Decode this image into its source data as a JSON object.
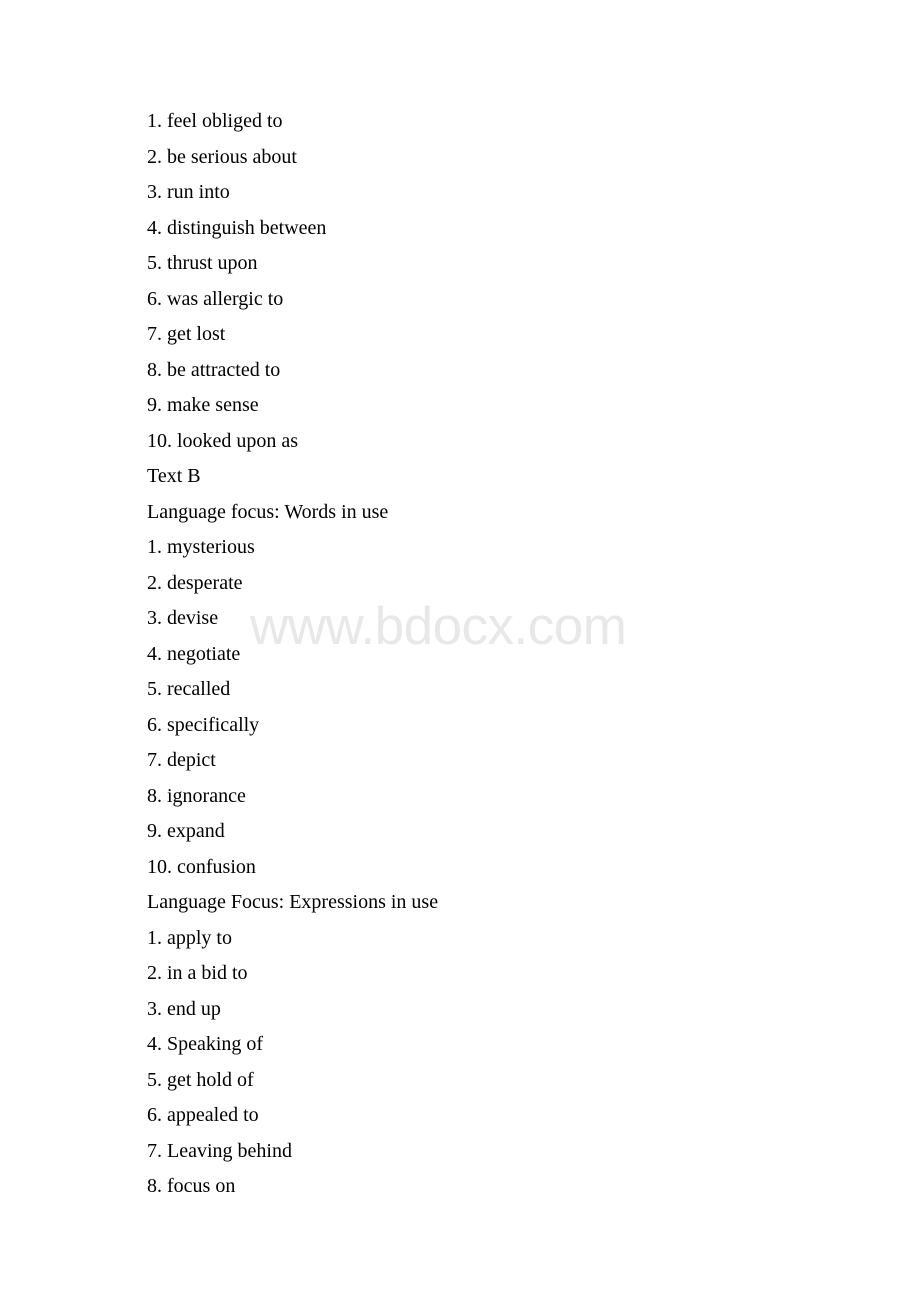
{
  "document": {
    "watermark": "www.bdocx.com",
    "watermark_color": "#e8e8e8",
    "text_color": "#000000",
    "lines": [
      "1. feel obliged to",
      "2. be serious about",
      "3. run into",
      "4. distinguish between",
      "5. thrust upon",
      "6. was allergic to",
      "7. get lost",
      "8. be attracted to",
      "9. make sense",
      "10. looked upon as",
      "Text B",
      "Language focus: Words in use",
      "1. mysterious",
      "2. desperate",
      "3. devise",
      "4. negotiate",
      "5. recalled",
      "6. specifically",
      "7. depict",
      "8. ignorance",
      "9. expand",
      "10. confusion",
      "Language Focus: Expressions in use",
      "1. apply to",
      "2. in a bid to",
      "3. end up",
      "4. Speaking of",
      "5. get hold of",
      "6. appealed to",
      "7. Leaving behind",
      "8. focus on"
    ]
  }
}
